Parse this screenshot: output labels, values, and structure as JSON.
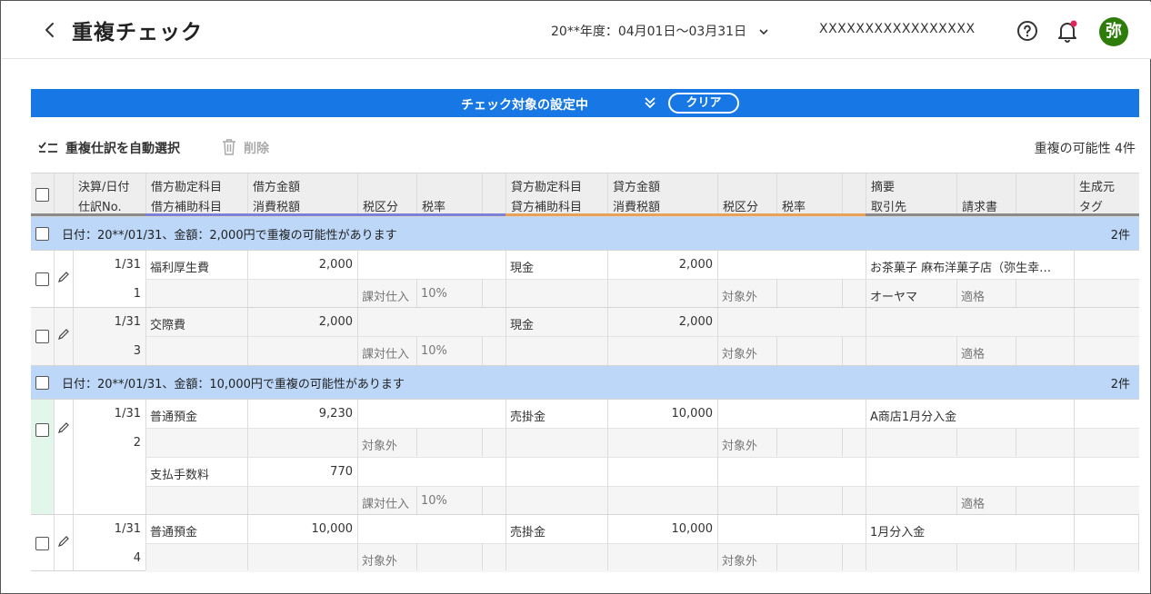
{
  "header": {
    "title": "重複チェック",
    "fiscal_period": "20**年度：04月01日〜03月31日",
    "company": "XXXXXXXXXXXXXXXXX",
    "avatar_text": "弥"
  },
  "banner": {
    "text": "チェック対象の設定中",
    "clear_label": "クリア"
  },
  "toolbar": {
    "auto_select_label": "重複仕訳を自動選択",
    "delete_label": "削除",
    "duplicate_count": "重複の可能性 4件"
  },
  "table": {
    "headers": {
      "date": "決算/日付",
      "slip_no": "仕訳No.",
      "debit_account": "借方勘定科目",
      "debit_sub": "借方補助科目",
      "debit_amount": "借方金額",
      "debit_tax": "消費税額",
      "debit_tax_class": "税区分",
      "debit_tax_rate": "税率",
      "credit_account": "貸方勘定科目",
      "credit_sub": "貸方補助科目",
      "credit_amount": "貸方金額",
      "credit_tax": "消費税額",
      "credit_tax_class": "税区分",
      "credit_tax_rate": "税率",
      "memo": "摘要",
      "partner": "取引先",
      "invoice": "請求書",
      "source": "生成元",
      "tag": "タグ"
    },
    "groups": [
      {
        "text": "日付：20**/01/31、金額：2,000円で重複の可能性があります",
        "count": "2件",
        "entries": [
          {
            "date": "1/31",
            "no": "1",
            "lines": [
              {
                "debit_account": "福利厚生費",
                "debit_amount": "2,000",
                "credit_account": "現金",
                "credit_amount": "2,000",
                "memo": "お茶菓子 麻布洋菓子店（弥生幸…",
                "debit_tax_class": "課対仕入",
                "debit_tax_rate": "10%",
                "credit_tax_class": "対象外",
                "partner": "オーヤマ",
                "invoice": "適格"
              }
            ]
          },
          {
            "date": "1/31",
            "no": "3",
            "lines": [
              {
                "debit_account": "交際費",
                "debit_amount": "2,000",
                "credit_account": "現金",
                "credit_amount": "2,000",
                "memo": "",
                "debit_tax_class": "課対仕入",
                "debit_tax_rate": "10%",
                "credit_tax_class": "対象外",
                "partner": "",
                "invoice": "適格"
              }
            ]
          }
        ]
      },
      {
        "text": "日付：20**/01/31、金額：10,000円で重複の可能性があります",
        "count": "2件",
        "entries": [
          {
            "date": "1/31",
            "no": "2",
            "lines": [
              {
                "debit_account": "普通預金",
                "debit_amount": "9,230",
                "credit_account": "売掛金",
                "credit_amount": "10,000",
                "memo": "A商店1月分入金",
                "debit_tax_class": "対象外",
                "debit_tax_rate": "",
                "credit_tax_class": "対象外",
                "partner": "",
                "invoice": ""
              },
              {
                "debit_account": "支払手数料",
                "debit_amount": "770",
                "credit_account": "",
                "credit_amount": "",
                "memo": "",
                "debit_tax_class": "課対仕入",
                "debit_tax_rate": "10%",
                "credit_tax_class": "",
                "partner": "",
                "invoice": "適格"
              }
            ]
          },
          {
            "date": "1/31",
            "no": "4",
            "lines": [
              {
                "debit_account": "普通預金",
                "debit_amount": "10,000",
                "credit_account": "売掛金",
                "credit_amount": "10,000",
                "memo": "1月分入金",
                "debit_tax_class": "対象外",
                "debit_tax_rate": "",
                "credit_tax_class": "対象外",
                "partner": "",
                "invoice": ""
              }
            ]
          }
        ]
      }
    ]
  },
  "colors": {
    "banner": "#1677e5",
    "group_row": "#bcd7f7",
    "debit_underline": "#7c80d8",
    "credit_underline": "#e8a15a",
    "avatar": "#2e7d0a",
    "notification_dot": "#e0245e"
  }
}
